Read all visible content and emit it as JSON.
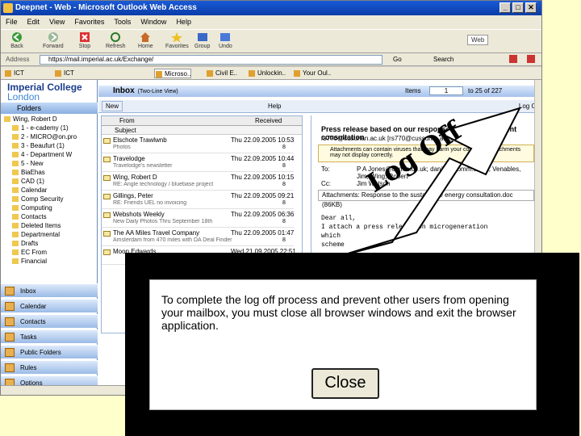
{
  "window": {
    "title": "Deepnet - Web - Microsoft Outlook Web Access",
    "buttons": [
      "_",
      "□",
      "✕"
    ]
  },
  "menu": [
    "File",
    "Edit",
    "View",
    "Favorites",
    "Tools",
    "Window",
    "Help"
  ],
  "toolbar": {
    "back": "Back",
    "forward": "Forward",
    "stop": "Stop",
    "refresh": "Refresh",
    "home": "Home",
    "favorites": "Favorites",
    "group": "Group",
    "undo": "Undo",
    "web": "Web"
  },
  "address": {
    "label": "Address",
    "url": "https://mail.imperial.ac.uk/Exchange/",
    "go": "Go",
    "search": "Search"
  },
  "tabs": [
    "ICT",
    "ICT",
    "Microso..",
    "Civil E..",
    "Unlockin..",
    "Your Oul.."
  ],
  "owa": {
    "logo_line1": "Imperial College",
    "logo_line2": "London",
    "folders_label": "Folders",
    "folders": [
      "Wing, Robert D",
      "1 - e-cademy (1)",
      "2 - MICRO@on.pro",
      "3 - Beaufurt (1)",
      "4 - Department W",
      "5 - New",
      "BiaEhas",
      "CAD (1)",
      "Calendar",
      "Comp Security",
      "Computing",
      "Contacts",
      "Deleted Items",
      "Departmental",
      "Drafts",
      "EC From",
      "Financial"
    ],
    "nav": [
      "Inbox",
      "Calendar",
      "Contacts",
      "Tasks",
      "Public Folders",
      "Rules",
      "Options"
    ],
    "inbox_title": "Inbox",
    "inbox_sub": "(Two-Line View)",
    "items_label": "Items",
    "page_value": "1",
    "page_total": "to 25 of 227",
    "new_label": "New",
    "help_label": "Help",
    "logoff_label": "Log Off",
    "list_header_from": "From",
    "list_header_received": "Received",
    "list_header_subject": "Subject",
    "messages": [
      {
        "from": "Elschote Trawlwnb",
        "date": "Thu 22.09.2005 10:53",
        "preview": "Photos",
        "size": "8"
      },
      {
        "from": "Travelodge",
        "date": "Thu 22.09.2005 10:44",
        "preview": "Travelodge's newsletter",
        "size": "8"
      },
      {
        "from": "Wing, Robert D",
        "date": "Thu 22.09.2005 10:15",
        "preview": "RE: Angle technology / bluebase project",
        "size": "8"
      },
      {
        "from": "Gillings, Peter",
        "date": "Thu 22.09.2005 09:21",
        "preview": "RE: Friends UEL no invoicing",
        "size": "8"
      },
      {
        "from": "Webshots Weekly",
        "date": "Thu 22.09.2005 06:36",
        "preview": "New Daily Photos Thru September 18th",
        "size": "8"
      },
      {
        "from": "The AA Miles Travel Company",
        "date": "Thu 22.09.2005 01:47",
        "preview": "Amsterdam from 470 miles with DA Deal Finder",
        "size": "8"
      },
      {
        "from": "Moon Edwards",
        "date": "Wed 21.09.2005 22:51",
        "preview": "",
        "size": "8"
      }
    ],
    "reading": {
      "subject": "Press release based on our response to the Government consultation",
      "from": "rs770@cusurlan.ac.uk [rs770@cussuran.ac.uk]",
      "warning": "Attachments can contain viruses that may harm your computer. Attachments may not display correctly.",
      "to_label": "To:",
      "to_value": "P A Jones@comm.co.uk; daniel@comm.co.uk; Venables, Jim; Wing, Robert",
      "cc_label": "Cc:",
      "cc_value": "Jim Watson",
      "attach_label": "Attachments:",
      "attach_value": "Response to the sustainable energy consultation.doc (86KB)",
      "body": [
        "Dear all,",
        "I attach a press release on microgeneration",
        "which",
        "scheme"
      ]
    }
  },
  "annotation": {
    "text": "Log Off"
  },
  "dialog": {
    "message": "To complete the log off process and prevent other users from opening your mailbox, you must close all browser windows and exit the browser application.",
    "close_label": "Close"
  }
}
